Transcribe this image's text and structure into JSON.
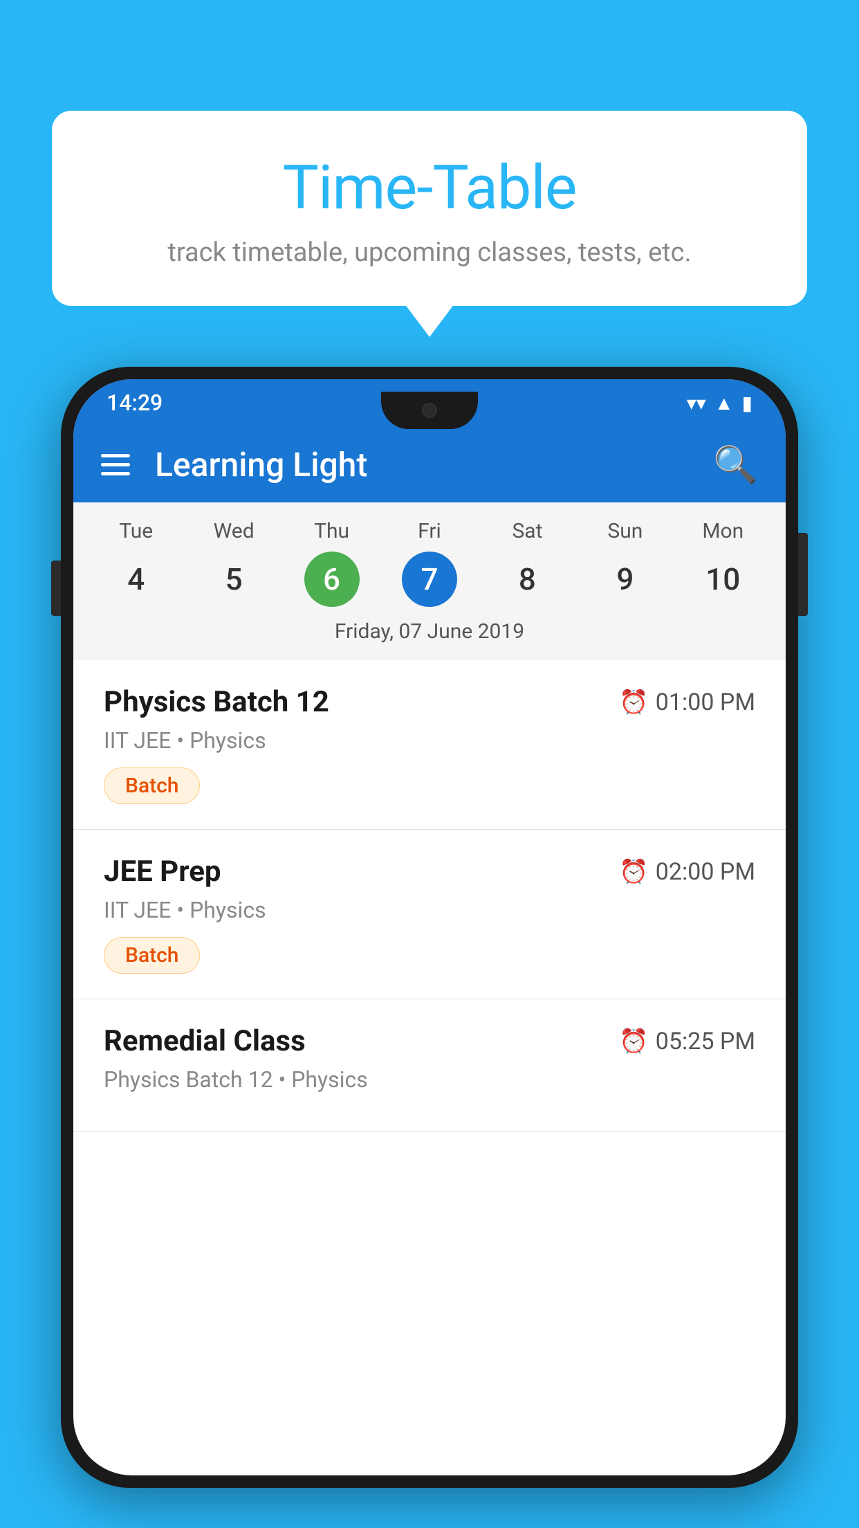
{
  "background_color": "#29B6F6",
  "speech_bubble": {
    "title": "Time-Table",
    "subtitle": "track timetable, upcoming classes, tests, etc."
  },
  "phone": {
    "status_bar": {
      "time": "14:29",
      "icons": [
        "wifi",
        "signal",
        "battery"
      ]
    },
    "app_bar": {
      "title": "Learning Light",
      "menu_icon": "hamburger",
      "search_icon": "search"
    },
    "calendar": {
      "days": [
        {
          "label": "Tue",
          "number": "4",
          "state": "normal"
        },
        {
          "label": "Wed",
          "number": "5",
          "state": "normal"
        },
        {
          "label": "Thu",
          "number": "6",
          "state": "today"
        },
        {
          "label": "Fri",
          "number": "7",
          "state": "selected"
        },
        {
          "label": "Sat",
          "number": "8",
          "state": "normal"
        },
        {
          "label": "Sun",
          "number": "9",
          "state": "normal"
        },
        {
          "label": "Mon",
          "number": "10",
          "state": "normal"
        }
      ],
      "selected_date_label": "Friday, 07 June 2019"
    },
    "classes": [
      {
        "name": "Physics Batch 12",
        "time": "01:00 PM",
        "meta": "IIT JEE • Physics",
        "tag": "Batch"
      },
      {
        "name": "JEE Prep",
        "time": "02:00 PM",
        "meta": "IIT JEE • Physics",
        "tag": "Batch"
      },
      {
        "name": "Remedial Class",
        "time": "05:25 PM",
        "meta": "Physics Batch 12 • Physics",
        "tag": null
      }
    ]
  }
}
